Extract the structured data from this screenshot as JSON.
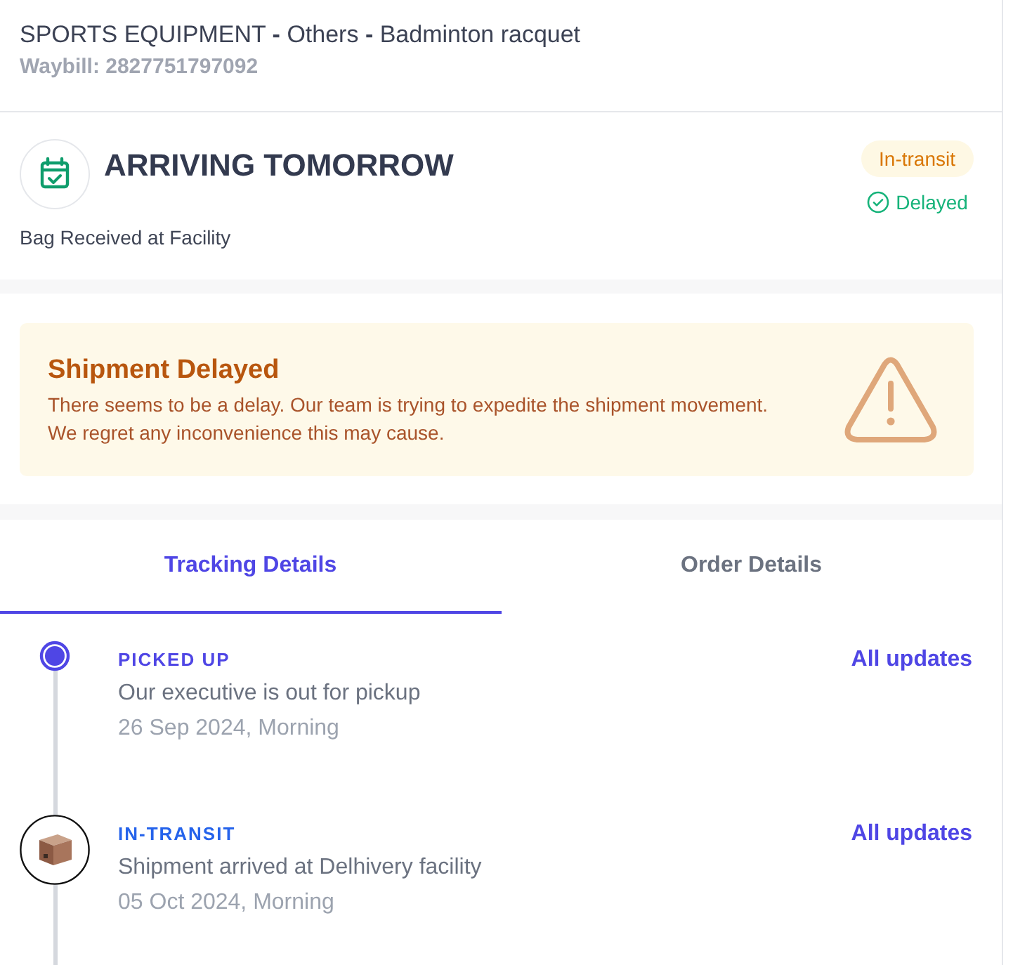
{
  "header": {
    "title": "SPORTS EQUIPMENT **-** Others **-** Badminton racquet",
    "waybill": "Waybill: 2827751797092"
  },
  "status": {
    "title": "ARRIVING TOMORROW",
    "subtitle": "Bag Received at Facility",
    "badge": "In-transit",
    "flag": "Delayed"
  },
  "alert": {
    "title": "Shipment Delayed",
    "message": "There seems to be a delay. Our team is trying to expedite the shipment movement. We regret any inconvenience this may cause."
  },
  "tabs": [
    {
      "label": "Tracking Details",
      "selected": true
    },
    {
      "label": "Order Details",
      "selected": false
    }
  ],
  "timeline": [
    {
      "kind": "dot",
      "status": "PICKED UP",
      "description": "Our executive is out for pickup",
      "date": "26 Sep 2024, Morning",
      "link": "All updates"
    },
    {
      "kind": "package",
      "status": "IN-TRANSIT",
      "description": "Shipment arrived at Delhivery facility",
      "date": "05 Oct 2024, Morning",
      "link": "All updates"
    }
  ]
}
